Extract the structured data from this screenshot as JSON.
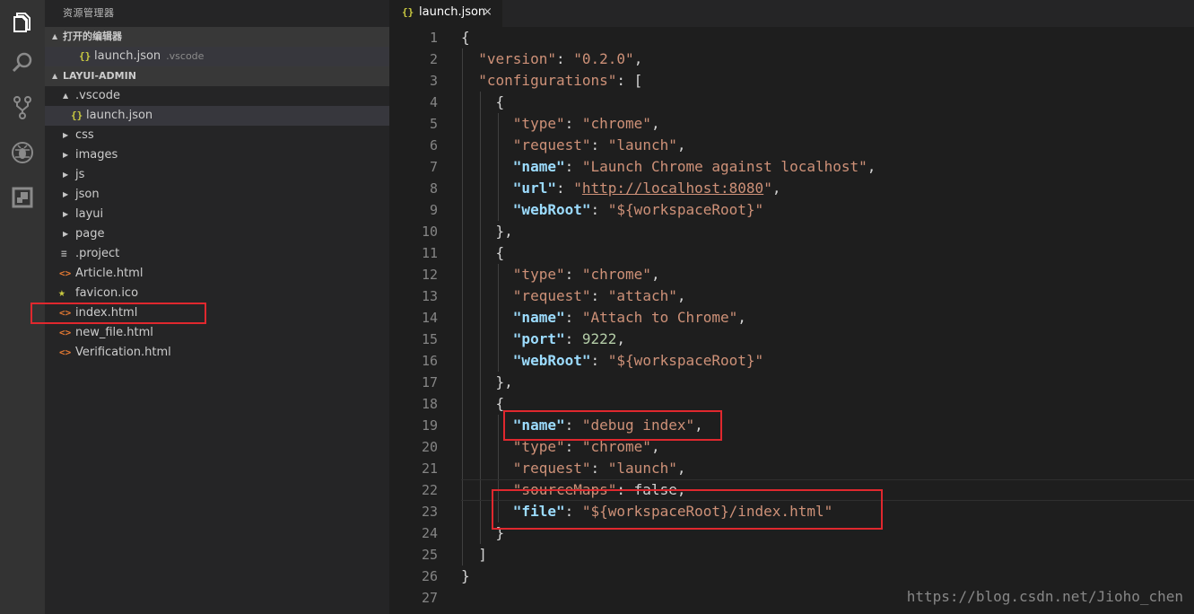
{
  "activity_bar": {
    "icons": [
      "explorer-icon",
      "search-icon",
      "source-control-icon",
      "debug-icon",
      "extensions-icon"
    ]
  },
  "sidebar": {
    "title": "资源管理器",
    "open_editors": {
      "header": "打开的编辑器",
      "items": [
        {
          "icon": "{}",
          "name": "launch.json",
          "desc": ".vscode"
        }
      ]
    },
    "project": {
      "header": "LAYUI-ADMIN",
      "items": [
        {
          "name": ".vscode",
          "twisty": "▲",
          "icon": ""
        },
        {
          "name": "launch.json",
          "twisty": "",
          "icon": "{}"
        },
        {
          "name": "css",
          "twisty": "▶",
          "icon": ""
        },
        {
          "name": "images",
          "twisty": "▶",
          "icon": ""
        },
        {
          "name": "js",
          "twisty": "▶",
          "icon": ""
        },
        {
          "name": "json",
          "twisty": "▶",
          "icon": ""
        },
        {
          "name": "layui",
          "twisty": "▶",
          "icon": ""
        },
        {
          "name": "page",
          "twisty": "▶",
          "icon": ""
        },
        {
          "name": ".project",
          "twisty": "",
          "icon": "≡"
        },
        {
          "name": "Article.html",
          "twisty": "",
          "icon": "<>"
        },
        {
          "name": "favicon.ico",
          "twisty": "",
          "icon": "★"
        },
        {
          "name": "index.html",
          "twisty": "",
          "icon": "<>"
        },
        {
          "name": "new_file.html",
          "twisty": "",
          "icon": "<>"
        },
        {
          "name": "Verification.html",
          "twisty": "",
          "icon": "<>"
        }
      ]
    }
  },
  "tab": {
    "icon": "{}",
    "label": "launch.json",
    "close": "×"
  },
  "editor": {
    "line_numbers": [
      "1",
      "2",
      "3",
      "4",
      "5",
      "6",
      "7",
      "8",
      "9",
      "10",
      "11",
      "12",
      "13",
      "14",
      "15",
      "16",
      "17",
      "18",
      "19",
      "20",
      "21",
      "22",
      "23",
      "24",
      "25",
      "26",
      "27"
    ],
    "lines": [
      "{",
      "  \"version\": \"0.2.0\",",
      "  \"configurations\": [",
      "    {",
      "      \"type\": \"chrome\",",
      "      \"request\": \"launch\",",
      "      \"name\": \"Launch Chrome against localhost\",",
      "      \"url\": \"http://localhost:8080\",",
      "      \"webRoot\": \"${workspaceRoot}\"",
      "    },",
      "    {",
      "      \"type\": \"chrome\",",
      "      \"request\": \"attach\",",
      "      \"name\": \"Attach to Chrome\",",
      "      \"port\": 9222,",
      "      \"webRoot\": \"${workspaceRoot}\"",
      "    },",
      "    {",
      "      \"name\": \"debug index\",",
      "      \"type\": \"chrome\",",
      "      \"request\": \"launch\",",
      "      \"sourceMaps\": false,",
      "      \"file\": \"${workspaceRoot}/index.html\"",
      "    }",
      "  ]",
      "}",
      ""
    ]
  },
  "watermark": "https://blog.csdn.net/Jioho_chen",
  "colors": {
    "highlight_box": "#e0282e",
    "json_icon": "#cbcb41",
    "html_icon": "#e37933",
    "string": "#ce9178",
    "key_bold": "#9cdcfe",
    "number": "#b5cea8",
    "boolean": "#569cd6"
  }
}
